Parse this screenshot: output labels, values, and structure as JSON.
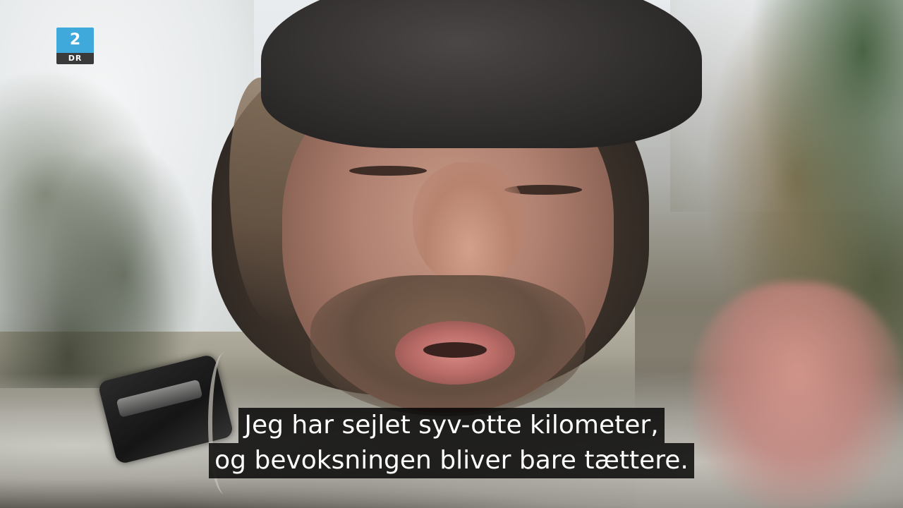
{
  "channel_logo": {
    "number": "2",
    "name": "DR",
    "colors": {
      "top": "#3fa9dc",
      "bottom": "#3a3a3a"
    }
  },
  "subtitles": {
    "line1": "Jeg har sejlet syv-otte kilometer,",
    "line2": "og bevoksningen bliver bare tættere."
  }
}
